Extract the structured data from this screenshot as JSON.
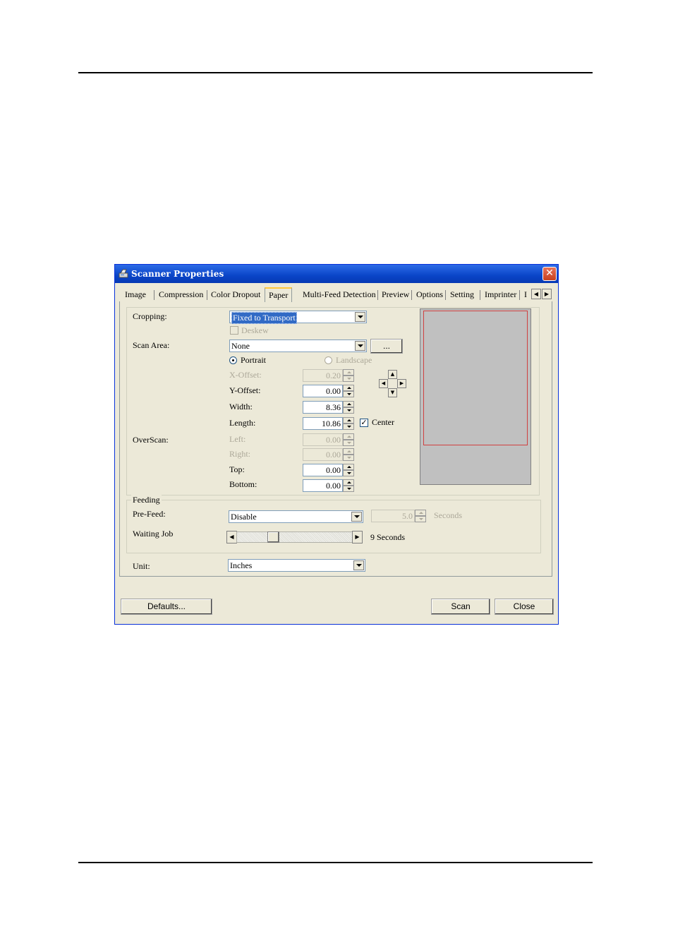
{
  "window": {
    "title": "Scanner Properties",
    "close_glyph": "✕",
    "title_icon": "scanner-icon"
  },
  "tabs": [
    "Image",
    "Compression",
    "Color Dropout",
    "Paper",
    "Multi-Feed Detection",
    "Preview",
    "Options",
    "Setting",
    "Imprinter",
    "I"
  ],
  "active_tab": "Paper",
  "paper": {
    "cropping_label": "Cropping:",
    "cropping_value": "Fixed to Transport",
    "deskew_label": "Deskew",
    "scan_area_label": "Scan Area:",
    "scan_area_value": "None",
    "browse_label": "...",
    "portrait_label": "Portrait",
    "landscape_label": "Landscape",
    "x_offset_label": "X-Offset:",
    "x_offset_value": "0.20",
    "y_offset_label": "Y-Offset:",
    "y_offset_value": "0.00",
    "width_label": "Width:",
    "width_value": "8.36",
    "length_label": "Length:",
    "length_value": "10.86",
    "center_label": "Center",
    "center_check": "✓",
    "overscan_label": "OverScan:",
    "left_label": "Left:",
    "left_value": "0.00",
    "right_label": "Right:",
    "right_value": "0.00",
    "top_label": "Top:",
    "top_value": "0.00",
    "bottom_label": "Bottom:",
    "bottom_value": "0.00"
  },
  "feeding": {
    "legend": "Feeding",
    "prefeed_label": "Pre-Feed:",
    "prefeed_value": "Disable",
    "prefeed_seconds_value": "5.0",
    "seconds_label": "Seconds",
    "waiting_job_label": "Waiting Job",
    "waiting_job_value": "9 Seconds"
  },
  "unit": {
    "label": "Unit:",
    "value": "Inches"
  },
  "buttons": {
    "defaults": "Defaults...",
    "scan": "Scan",
    "close": "Close"
  },
  "colors": {
    "titlebar": "#0a45c8",
    "window_bg": "#ece9d8",
    "selection": "#316ac5",
    "preview_frame": "#d04040"
  }
}
